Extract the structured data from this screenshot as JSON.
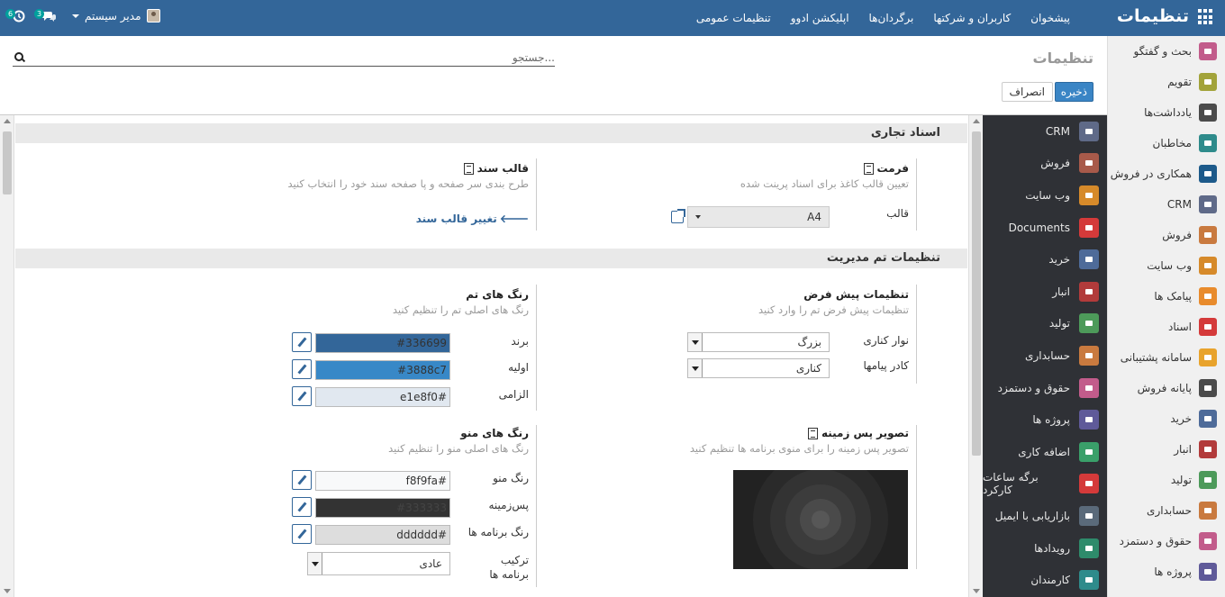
{
  "navbar": {
    "brand": "تنظیمات",
    "menu": [
      "پیشخوان",
      "کاربران و شرکتها",
      "برگردان‌ها",
      "اپلیکشن ادوو",
      "تنظیمات عمومی"
    ],
    "user": "مدیر سیستم",
    "chat_badge": "3",
    "activity_badge": "6"
  },
  "sidebar": {
    "items": [
      {
        "label": "بحث و گفتگو",
        "icon": "chat-icon",
        "color": "#c25c8b"
      },
      {
        "label": "تقویم",
        "icon": "calendar-icon",
        "color": "#a2a33a"
      },
      {
        "label": "یادداشت‌ها",
        "icon": "notes-icon",
        "color": "#4b4b4b"
      },
      {
        "label": "مخاطبان",
        "icon": "contacts-icon",
        "color": "#2e8b8b"
      },
      {
        "label": "همکاری در فروش",
        "icon": "partner-icon",
        "color": "#1d5a8a"
      },
      {
        "label": "CRM",
        "icon": "handshake-icon",
        "color": "#5f6a88"
      },
      {
        "label": "فروش",
        "icon": "chart-icon",
        "color": "#c97a3f"
      },
      {
        "label": "وب سایت",
        "icon": "globe-icon",
        "color": "#d68a2a"
      },
      {
        "label": "پیامک ها",
        "icon": "sms-icon",
        "color": "#e88b2c"
      },
      {
        "label": "اسناد",
        "icon": "folder-icon",
        "color": "#d43a3a"
      },
      {
        "label": "سامانه پشتیبانی",
        "icon": "headset-icon",
        "color": "#e8a32c"
      },
      {
        "label": "پایانه فروش",
        "icon": "store-icon",
        "color": "#4b4b4b"
      },
      {
        "label": "خرید",
        "icon": "card-icon",
        "color": "#4e6b99"
      },
      {
        "label": "انبار",
        "icon": "boxes-icon",
        "color": "#b23b3b"
      },
      {
        "label": "تولید",
        "icon": "wrench-icon",
        "color": "#4d9a5a"
      },
      {
        "label": "حسابداری",
        "icon": "ledger-icon",
        "color": "#c97a3f"
      },
      {
        "label": "حقوق و دستمزد",
        "icon": "payroll-icon",
        "color": "#c25c8b"
      },
      {
        "label": "پروژه ها",
        "icon": "puzzle-icon",
        "color": "#5f5a99"
      }
    ]
  },
  "subnav": {
    "items": [
      {
        "label": "CRM",
        "icon": "handshake-icon",
        "color": "#5f6a88"
      },
      {
        "label": "فروش",
        "icon": "chart-icon",
        "color": "#a85a4a"
      },
      {
        "label": "وب سایت",
        "icon": "globe-icon",
        "color": "#d68a2a"
      },
      {
        "label": "Documents",
        "icon": "folder-icon",
        "color": "#d43a3a"
      },
      {
        "label": "خرید",
        "icon": "card-icon",
        "color": "#4e6b99"
      },
      {
        "label": "انبار",
        "icon": "boxes-icon",
        "color": "#b23b3b"
      },
      {
        "label": "تولید",
        "icon": "wrench-icon",
        "color": "#4d9a5a"
      },
      {
        "label": "حسابداری",
        "icon": "ledger-icon",
        "color": "#c97a3f"
      },
      {
        "label": "حقوق و دستمزد",
        "icon": "payroll-icon",
        "color": "#c25c8b"
      },
      {
        "label": "پروژه ها",
        "icon": "puzzle-icon",
        "color": "#5f5a99"
      },
      {
        "label": "اضافه کاری",
        "icon": "timesheet-icon",
        "color": "#3aa06a"
      },
      {
        "label": "برگه ساعات کارکرد",
        "icon": "stopwatch-icon",
        "color": "#d43a3a"
      },
      {
        "label": "بازاریابی با ایمیل",
        "icon": "send-icon",
        "color": "#5a6a7a"
      },
      {
        "label": "رویدادها",
        "icon": "ticket-icon",
        "color": "#2e8b6b"
      },
      {
        "label": "کارمندان",
        "icon": "employees-icon",
        "color": "#2e8b8b"
      }
    ]
  },
  "cpanel": {
    "title": "تنظیمات",
    "search_placeholder": "جستجو...",
    "save": "ذخیره",
    "cancel": "انصراف"
  },
  "sections": {
    "business_docs": {
      "title": "اسناد تجاری",
      "format": {
        "title": "فرمت",
        "desc": "تعیین قالب کاغذ برای اسناد پرینت شده",
        "label": "قالب",
        "value": "A4"
      },
      "doc_layout": {
        "title": "قالب سند",
        "desc": "طرح بندی سر صفحه و پا صفحه سند خود را انتخاب کنید",
        "link": "تغییر قالب سند"
      }
    },
    "theme": {
      "title": "تنظیمات تم مدیریت",
      "defaults": {
        "title": "تنظیمات پیش فرض",
        "desc": "تنظیمات پیش فرض تم را وارد کنید",
        "sidebar_label": "نوار کناری",
        "sidebar_value": "بزرگ",
        "chatter_label": "کادر پیامها",
        "chatter_value": "کناری"
      },
      "colors": {
        "title": "رنگ های تم",
        "desc": "رنگ های اصلی تم را تنظیم کنید",
        "brand_label": "برند",
        "brand_value": "#336699",
        "primary_label": "اولیه",
        "primary_value": "#3888c7",
        "required_label": "الزامی",
        "required_value": "e1e8f0#"
      },
      "background": {
        "title": "تصویر پس زمینه",
        "desc": "تصویر پس زمینه را برای منوی برنامه ها تنظیم کنید"
      },
      "menu_colors": {
        "title": "رنگ های منو",
        "desc": "رنگ های اصلی منو را تنظیم کنید",
        "menu_label": "رنگ منو",
        "menu_value": "f8f9fa#",
        "bg_label": "پس‌زمینه",
        "bg_value": "#333333",
        "app_label": "رنگ برنامه ها",
        "app_value": "dddddd#",
        "layout_label": "ترکیب برنامه ها",
        "layout_value": "عادی"
      }
    }
  }
}
